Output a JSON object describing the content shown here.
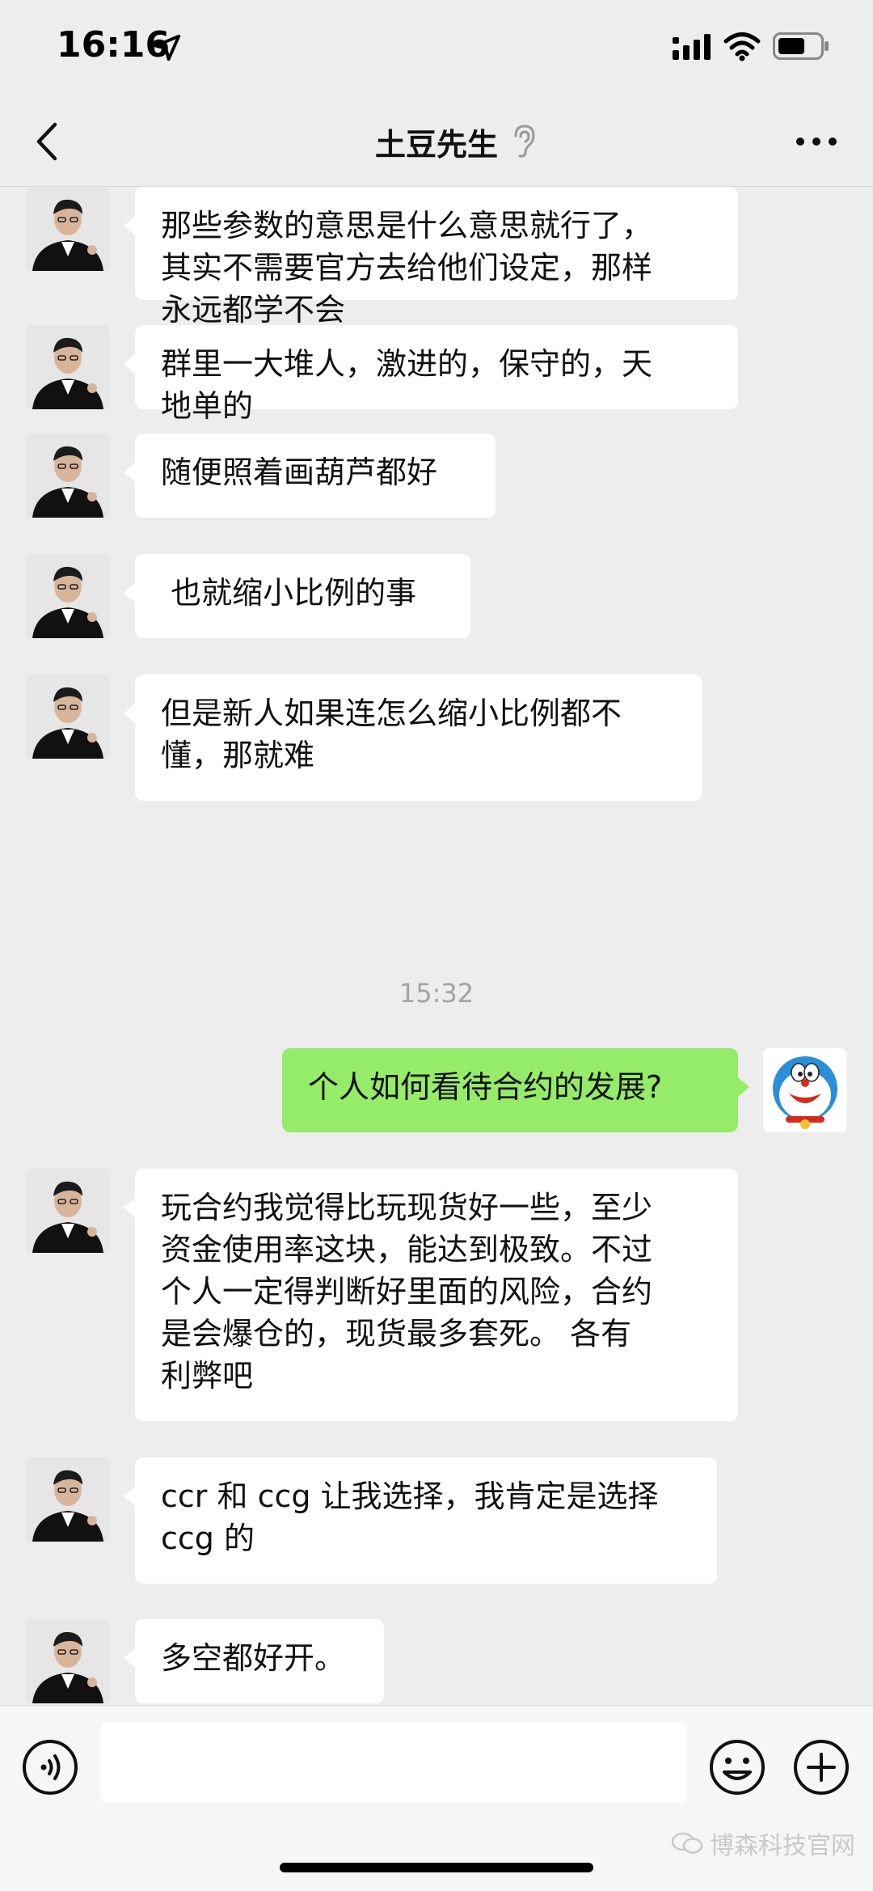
{
  "status_bar": {
    "time": "16:16"
  },
  "header": {
    "title": "土豆先生"
  },
  "messages": [
    {
      "side": "left",
      "text": "那些参数的意思是什么意思就行了，\n其实不需要官方去给他们设定，那样\n永远都学不会"
    },
    {
      "side": "left",
      "text": "群里一大堆人，激进的，保守的，天\n地单的"
    },
    {
      "side": "left",
      "text": "随便照着画葫芦都好"
    },
    {
      "side": "left",
      "text": " 也就缩小比例的事"
    },
    {
      "side": "left",
      "text": "但是新人如果连怎么缩小比例都不\n懂，那就难"
    },
    {
      "side": "right",
      "text": "个人如何看待合约的发展?"
    },
    {
      "side": "left",
      "text": "玩合约我觉得比玩现货好一些，至少\n资金使用率这块，能达到极致。不过\n个人一定得判断好里面的风险，合约\n是会爆仓的，现货最多套死。 各有\n利弊吧"
    },
    {
      "side": "left",
      "text": "ccr 和 ccg 让我选择，我肯定是选择\nccg 的"
    },
    {
      "side": "left",
      "text": "多空都好开。"
    }
  ],
  "timestamp": "15:32",
  "input": {
    "value": ""
  },
  "watermark": "博森科技官网",
  "colors": {
    "background": "#ededed",
    "self_bubble": "#95ec69",
    "other_bubble": "#ffffff"
  }
}
